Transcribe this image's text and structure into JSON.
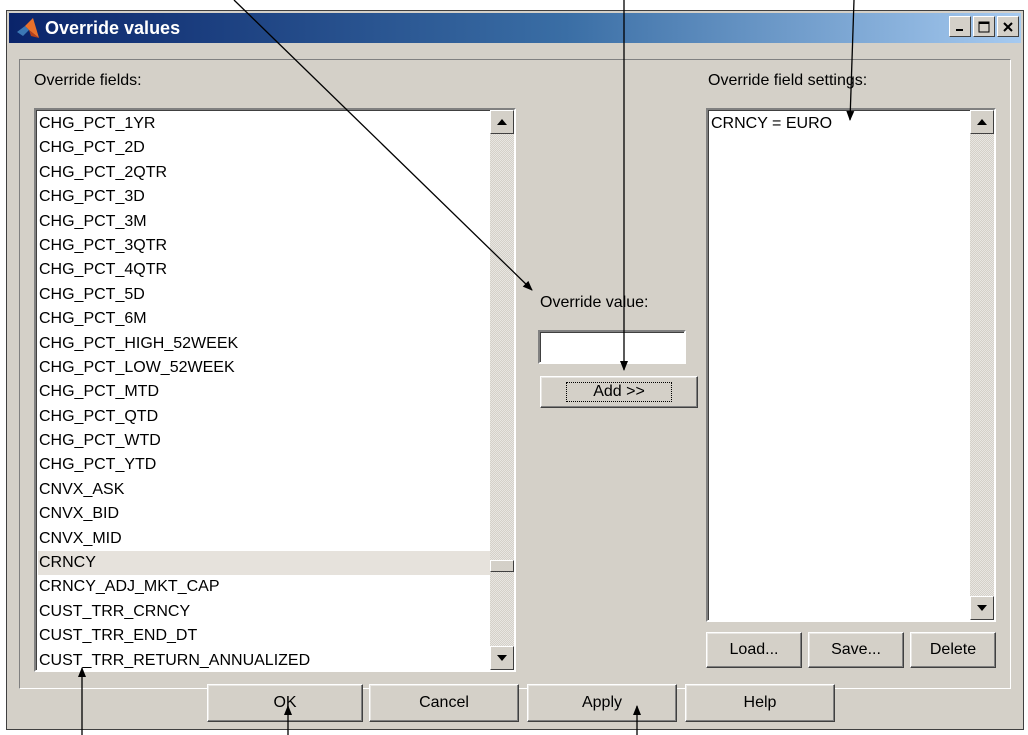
{
  "window": {
    "title": "Override values",
    "controls": [
      "minimize-icon",
      "maximize-icon",
      "close-icon"
    ]
  },
  "left": {
    "label": "Override fields:",
    "selected": "CRNCY",
    "items": [
      "CHG_PCT_1YR",
      "CHG_PCT_2D",
      "CHG_PCT_2QTR",
      "CHG_PCT_3D",
      "CHG_PCT_3M",
      "CHG_PCT_3QTR",
      "CHG_PCT_4QTR",
      "CHG_PCT_5D",
      "CHG_PCT_6M",
      "CHG_PCT_HIGH_52WEEK",
      "CHG_PCT_LOW_52WEEK",
      "CHG_PCT_MTD",
      "CHG_PCT_QTD",
      "CHG_PCT_WTD",
      "CHG_PCT_YTD",
      "CNVX_ASK",
      "CNVX_BID",
      "CNVX_MID",
      "CRNCY",
      "CRNCY_ADJ_MKT_CAP",
      "CUST_TRR_CRNCY",
      "CUST_TRR_END_DT",
      "CUST_TRR_RETURN_ANNUALIZED"
    ]
  },
  "middle": {
    "label": "Override value:",
    "value": "",
    "add_label": "Add >>"
  },
  "right": {
    "label": "Override field settings:",
    "items": [
      "CRNCY = EURO"
    ],
    "load_label": "Load...",
    "save_label": "Save...",
    "delete_label": "Delete"
  },
  "footer": {
    "ok_label": "OK",
    "cancel_label": "Cancel",
    "apply_label": "Apply",
    "help_label": "Help"
  },
  "colors": {
    "face": "#d4d0c8",
    "title_start": "#0a246a",
    "title_end": "#a6caf0",
    "selection": "#e6e2dc"
  }
}
